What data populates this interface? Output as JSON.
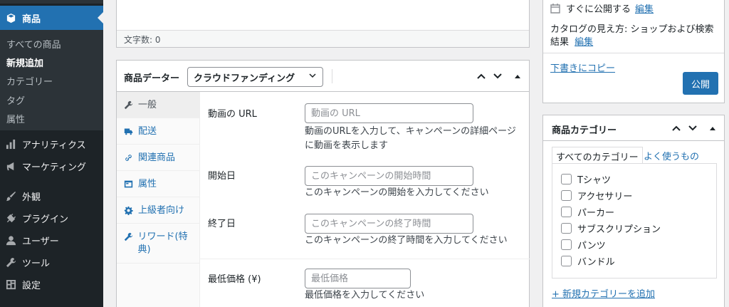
{
  "sidebar": {
    "current_menu": "商品",
    "submenu": [
      "すべての商品",
      "新規追加",
      "カテゴリー",
      "タグ",
      "属性"
    ],
    "submenu_current_index": 1,
    "items": [
      "アナリティクス",
      "マーケティング",
      "外観",
      "プラグイン",
      "ユーザー",
      "ツール",
      "設定"
    ],
    "accent_color": "#2271b1",
    "background_color": "#1d2327"
  },
  "editor": {
    "word_count": "文字数: 0"
  },
  "product_data": {
    "title": "商品データー",
    "type_selected": "クラウドファンディング",
    "tabs": [
      "一般",
      "配送",
      "関連商品",
      "属性",
      "上級者向け",
      "リワード(特典)"
    ],
    "tab_icons": [
      "wrench-icon",
      "truck-icon",
      "link-icon",
      "table-icon",
      "gear-icon",
      "wrench-icon"
    ],
    "active_tab_index": 0,
    "fields": {
      "video_url": {
        "label": "動画の URL",
        "placeholder": "動画の URL",
        "description": "動画のURLを入力して、キャンペーンの詳細ページに動画を表示します"
      },
      "start_date": {
        "label": "開始日",
        "placeholder": "このキャンペーンの開始時間",
        "description": "このキャンペーンの開始を入力してください"
      },
      "end_date": {
        "label": "終了日",
        "placeholder": "このキャンペーンの終了時間",
        "description": "このキャンペーンの終了時間を入力してください"
      },
      "min_price": {
        "label": "最低価格 (¥)",
        "placeholder": "最低価格",
        "description": "最低価格を入力してください"
      }
    }
  },
  "publish": {
    "publish_immediately": "すぐに公開する",
    "edit_link": "編集",
    "catalog_visibility": "カタログの見え方: ショップおよび検索結果",
    "catalog_edit_link": "編集",
    "copy_to_draft": "下書きにコピー",
    "publish_button": "公開"
  },
  "categories": {
    "title": "商品カテゴリー",
    "tab_all": "すべてのカテゴリー",
    "tab_popular": "よく使うもの",
    "items": [
      "Tシャツ",
      "アクセサリー",
      "パーカー",
      "サブスクリプション",
      "パンツ",
      "バンドル"
    ],
    "add_new": "+ 新規カテゴリーを追加"
  }
}
